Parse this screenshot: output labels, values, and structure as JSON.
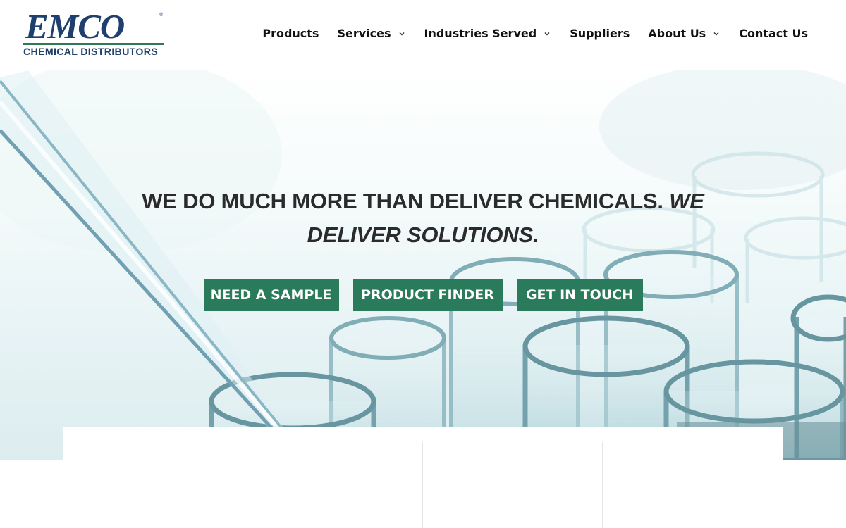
{
  "logo": {
    "name": "EMCO",
    "registered": "®",
    "tagline": "CHEMICAL DISTRIBUTORS"
  },
  "nav": {
    "items": [
      {
        "label": "Products",
        "has_dropdown": false
      },
      {
        "label": "Services",
        "has_dropdown": true
      },
      {
        "label": "Industries Served",
        "has_dropdown": true
      },
      {
        "label": "Suppliers",
        "has_dropdown": false
      },
      {
        "label": "About Us",
        "has_dropdown": true
      },
      {
        "label": "Contact Us",
        "has_dropdown": false
      }
    ]
  },
  "hero": {
    "headline_main": "WE DO MUCH MORE THAN DELIVER CHEMICALS.",
    "headline_emphasis": "WE DELIVER SOLUTIONS.",
    "buttons": {
      "sample": "NEED A SAMPLE",
      "finder": "PRODUCT FINDER",
      "contact": "GET IN TOUCH"
    }
  },
  "colors": {
    "brand_navy": "#1f3f6e",
    "brand_green": "#2e7a57",
    "button_green": "#2a7a5c"
  },
  "icons": {
    "dropdown": "chevron-down-icon"
  }
}
